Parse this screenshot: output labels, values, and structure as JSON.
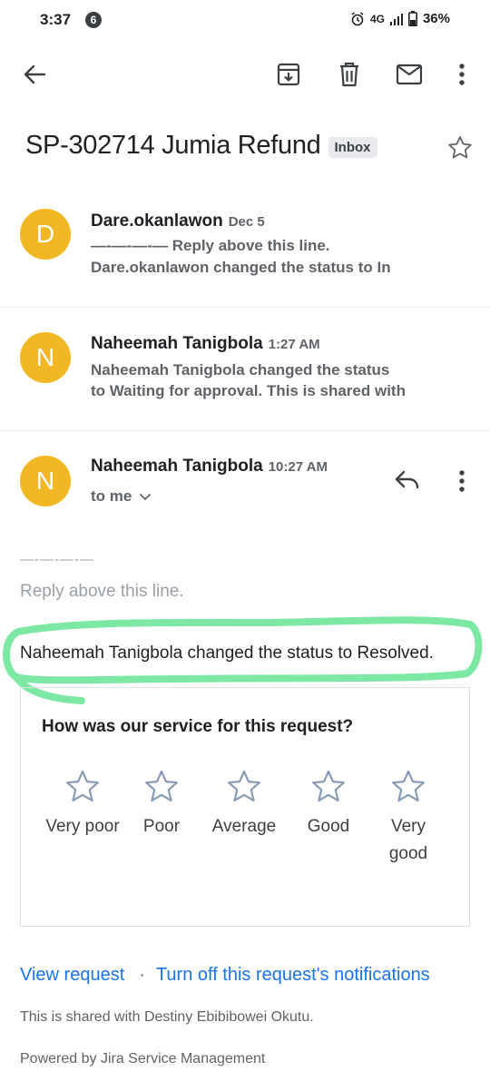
{
  "status_bar": {
    "time": "3:37",
    "notification_count": "6",
    "network": "4G",
    "battery": "36%"
  },
  "toolbar": {
    "icons": [
      "back-arrow-icon",
      "archive-icon",
      "delete-icon",
      "mark-unread-icon",
      "more-vert-icon"
    ]
  },
  "subject": {
    "title": "SP-302714 Jumia Refund",
    "label": "Inbox"
  },
  "messages": [
    {
      "avatar_letter": "D",
      "sender": "Dare.okanlawon",
      "time": "Dec 5",
      "snippet_line1": "—-—-—-— Reply above this line.",
      "snippet_line2": "Dare.okanlawon changed the status to In"
    },
    {
      "avatar_letter": "N",
      "sender": "Naheemah Tanigbola",
      "time": "1:27 AM",
      "snippet_line1": "Naheemah Tanigbola changed the status",
      "snippet_line2": "to Waiting for approval. This is shared with"
    },
    {
      "avatar_letter": "N",
      "sender": "Naheemah Tanigbola",
      "time": "10:27 AM",
      "recipient": "to me"
    }
  ],
  "body": {
    "dashes": "—-—-—-—",
    "reply_above": "Reply above this line.",
    "status_change": "Naheemah Tanigbola changed the status to Resolved.",
    "highlight_color": "#7de8a4"
  },
  "survey": {
    "question": "How was our service for this request?",
    "ratings": [
      "Very poor",
      "Poor",
      "Average",
      "Good",
      "Very good"
    ]
  },
  "footer": {
    "view_request": "View request",
    "separator": "·",
    "turn_off": "Turn off this request's notifications",
    "shared_with": "This is shared with Destiny Ebibibowei Okutu.",
    "powered_by": "Powered by Jira Service Management"
  },
  "colors": {
    "avatar": "#f2b824",
    "link": "#1a73e8"
  }
}
